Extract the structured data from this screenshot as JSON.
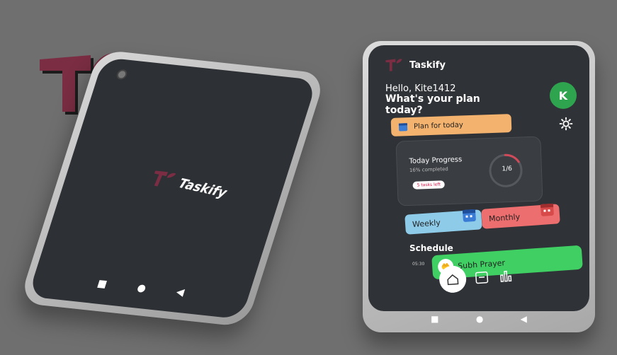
{
  "brand": {
    "name": "Taskify",
    "logo_color": "#7a2d43"
  },
  "left_phone": {
    "brand_text": "Taskify",
    "system_nav": {
      "back": "◀",
      "home": "●",
      "recents": "■"
    }
  },
  "right_phone": {
    "header": {
      "title": "Taskify"
    },
    "greeting": "Hello, Kite1412",
    "question": "What's your plan today?",
    "avatar_initial": "K",
    "plan_button": {
      "label": "Plan for today"
    },
    "progress": {
      "title": "Today Progress",
      "subtitle": "16% completed",
      "tasks_left": "5 tasks left",
      "ring_label": "1/6",
      "fraction": 0.16
    },
    "weekly_label": "Weekly",
    "monthly_label": "Monthly",
    "schedule": {
      "title": "Schedule",
      "items": [
        {
          "time": "05:30",
          "label": "Subh Prayer"
        }
      ]
    },
    "bottom_nav": [
      "home-icon",
      "calendar-icon",
      "chart-icon"
    ],
    "system_nav": {
      "back": "◀",
      "home": "●",
      "recents": "■"
    }
  },
  "colors": {
    "background": "#6f6f6f",
    "screen": "#2f3236",
    "plan": "#f3b26d",
    "weekly": "#8ecbe8",
    "monthly": "#ed6e6e",
    "schedule": "#3fcf63",
    "avatar": "#2ea44f"
  }
}
